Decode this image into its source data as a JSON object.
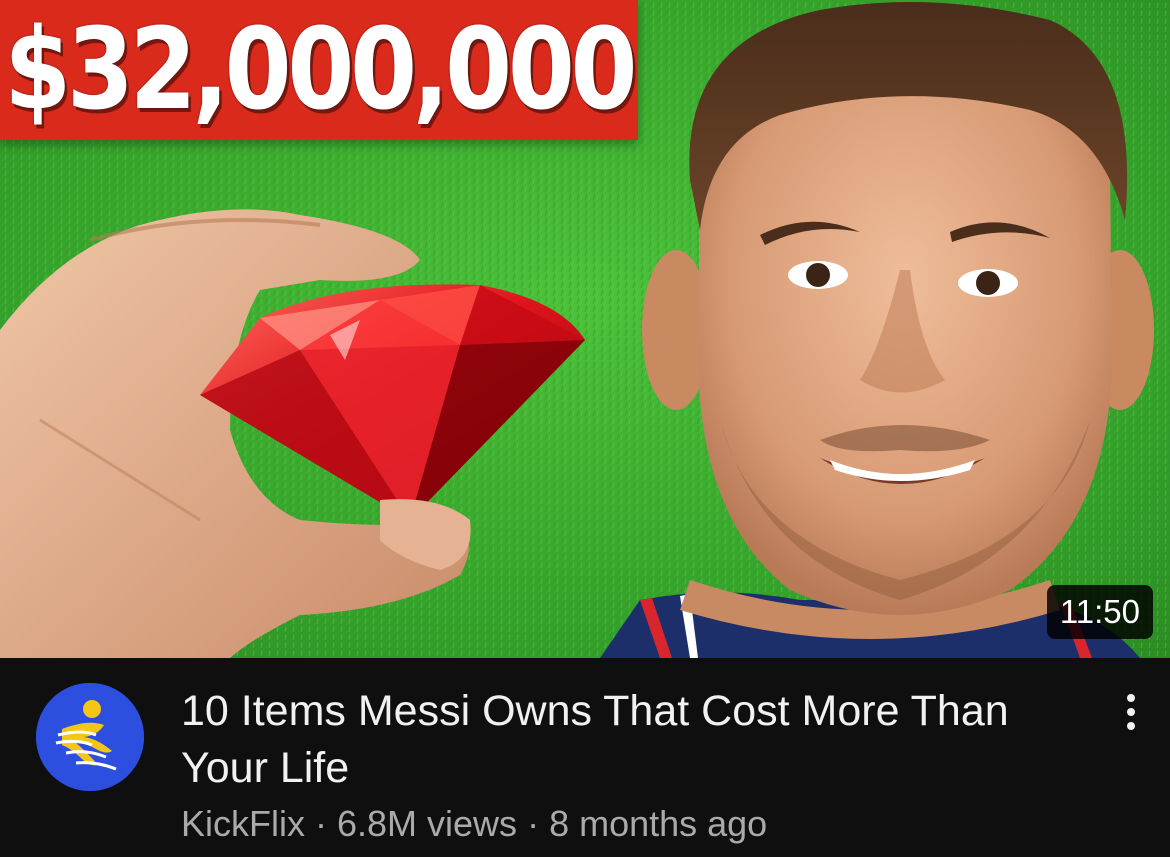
{
  "thumbnail": {
    "price_text": "$32,000,000",
    "duration": "11:50",
    "colors": {
      "grass": "#3aa52b",
      "banner": "#d92a1c",
      "gem": "#e0141c"
    },
    "icons": [
      "ruby-gem-icon"
    ]
  },
  "video": {
    "title": "10 Items Messi Owns That Cost More Than Your Life",
    "channel": "KickFlix",
    "separator": "·",
    "views": "6.8M views",
    "age": "8 months ago"
  },
  "channel_avatar": {
    "icon": "runner-logo-icon",
    "color": "#2d4fe0"
  },
  "menu": {
    "icon": "more-vertical-icon"
  }
}
